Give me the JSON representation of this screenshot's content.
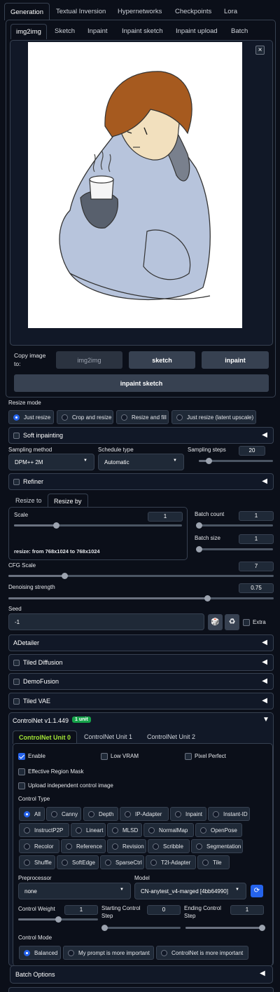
{
  "top_tabs": [
    "Generation",
    "Textual Inversion",
    "Hypernetworks",
    "Checkpoints",
    "Lora"
  ],
  "sub_tabs": [
    "img2img",
    "Sketch",
    "Inpaint",
    "Inpaint sketch",
    "Inpaint upload",
    "Batch"
  ],
  "image_close": "×",
  "copy_image": {
    "label": "Copy image to:",
    "buttons": [
      "img2img",
      "sketch",
      "inpaint"
    ],
    "wide_button": "inpaint sketch"
  },
  "resize_mode": {
    "label": "Resize mode",
    "options": [
      "Just resize",
      "Crop and resize",
      "Resize and fill",
      "Just resize (latent upscale)"
    ],
    "selected": "Just resize"
  },
  "soft_inpainting": "Soft inpainting",
  "sampling": {
    "method_label": "Sampling method",
    "method": "DPM++ 2M",
    "schedule_label": "Schedule type",
    "schedule": "Automatic",
    "steps_label": "Sampling steps",
    "steps": "20",
    "steps_fraction": 0.13
  },
  "refiner": "Refiner",
  "resize_tabs": [
    "Resize to",
    "Resize by"
  ],
  "scale": {
    "label": "Scale",
    "value": "1",
    "fraction": 0.25,
    "info": "resize: from 768x1024 to 768x1024"
  },
  "batch_count": {
    "label": "Batch count",
    "value": "1",
    "fraction": 0.0
  },
  "batch_size": {
    "label": "Batch size",
    "value": "1",
    "fraction": 0.0
  },
  "cfg": {
    "label": "CFG Scale",
    "value": "7",
    "fraction": 0.21
  },
  "denoise": {
    "label": "Denoising strength",
    "value": "0.75",
    "fraction": 0.75
  },
  "seed": {
    "label": "Seed",
    "value": "-1",
    "dice_icon": "🎲",
    "recycle_icon": "♻",
    "extra_label": "Extra"
  },
  "accordions": [
    "ADetailer",
    "Tiled Diffusion",
    "DemoFusion",
    "Tiled VAE"
  ],
  "controlnet": {
    "title": "ControlNet v1.1.449",
    "badge": "1 unit",
    "unit_tabs": [
      "ControlNet Unit 0",
      "ControlNet Unit 1",
      "ControlNet Unit 2"
    ],
    "enable": "Enable",
    "low_vram": "Low VRAM",
    "pixel_perfect": "Pixel Perfect",
    "effective_mask": "Effective Region Mask",
    "upload_independent": "Upload independent control image",
    "control_type_label": "Control Type",
    "control_types": [
      [
        "All",
        "Canny",
        "Depth",
        "IP-Adapter",
        "Inpaint",
        "Instant-ID"
      ],
      [
        "InstructP2P",
        "Lineart",
        "MLSD",
        "NormalMap",
        "OpenPose"
      ],
      [
        "Recolor",
        "Reference",
        "Revision",
        "Scribble",
        "Segmentation"
      ],
      [
        "Shuffle",
        "SoftEdge",
        "SparseCtrl",
        "T2I-Adapter",
        "Tile"
      ]
    ],
    "control_type_selected": "All",
    "preprocessor_label": "Preprocessor",
    "preprocessor": "none",
    "model_label": "Model",
    "model": "CN-anytest_v4-marged [4bb64990]",
    "refresh_icon": "⟳",
    "weight": {
      "label": "Control Weight",
      "value": "1",
      "fraction": 0.5
    },
    "start": {
      "label": "Starting Control Step",
      "value": "0",
      "fraction": 0.0
    },
    "end": {
      "label": "Ending Control Step",
      "value": "1",
      "fraction": 1.0
    },
    "mode_label": "Control Mode",
    "modes": [
      "Balanced",
      "My prompt is more important",
      "ControlNet is more important"
    ],
    "mode_selected": "Balanced"
  },
  "batch_options": "Batch Options",
  "colors": {
    "accent": "#2563eb",
    "badge": "#16a34a",
    "unit_tab": "#a3e635",
    "bg": "#0b0f19"
  }
}
